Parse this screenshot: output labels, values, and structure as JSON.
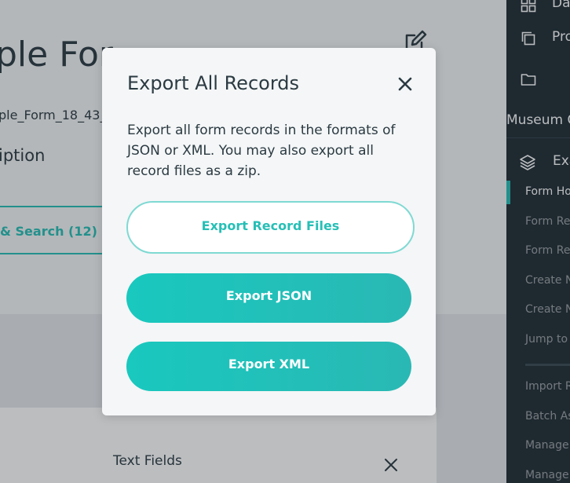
{
  "page": {
    "title": "ple For",
    "form_id": "ple_Form_18_43_",
    "description_label": "iption",
    "search_button_label": "& Search (12)",
    "text_fields_label": "Text Fields"
  },
  "sidebar": {
    "top_items": [
      {
        "label": "Da",
        "icon": "dashboard-icon"
      },
      {
        "label": "Pro",
        "icon": "projects-icon"
      },
      {
        "label": "",
        "icon": "folder-icon"
      }
    ],
    "project_name": "Museum C",
    "current_form": {
      "label": "Exa",
      "icon": "layers-icon"
    },
    "links": [
      {
        "label": "Form Ho",
        "active": true
      },
      {
        "label": "Form Re",
        "active": false
      },
      {
        "label": "Form Re",
        "active": false
      },
      {
        "label": "Create N",
        "active": false
      },
      {
        "label": "Create N",
        "active": false
      },
      {
        "label": "Jump to",
        "active": false
      }
    ],
    "links_after_divider": [
      {
        "label": "Import R",
        "active": false
      },
      {
        "label": "Batch As",
        "active": false
      },
      {
        "label": "Manage",
        "active": false
      },
      {
        "label": "Manage",
        "active": false
      }
    ]
  },
  "modal": {
    "title": "Export All Records",
    "description": "Export all form records in the formats of JSON or XML. You may also export all record files as a zip.",
    "buttons": {
      "files": "Export Record Files",
      "json": "Export JSON",
      "xml": "Export XML"
    }
  },
  "colors": {
    "accent": "#26bfb6",
    "sidebar_bg": "#1f2b33",
    "text": "#2b3a42"
  }
}
